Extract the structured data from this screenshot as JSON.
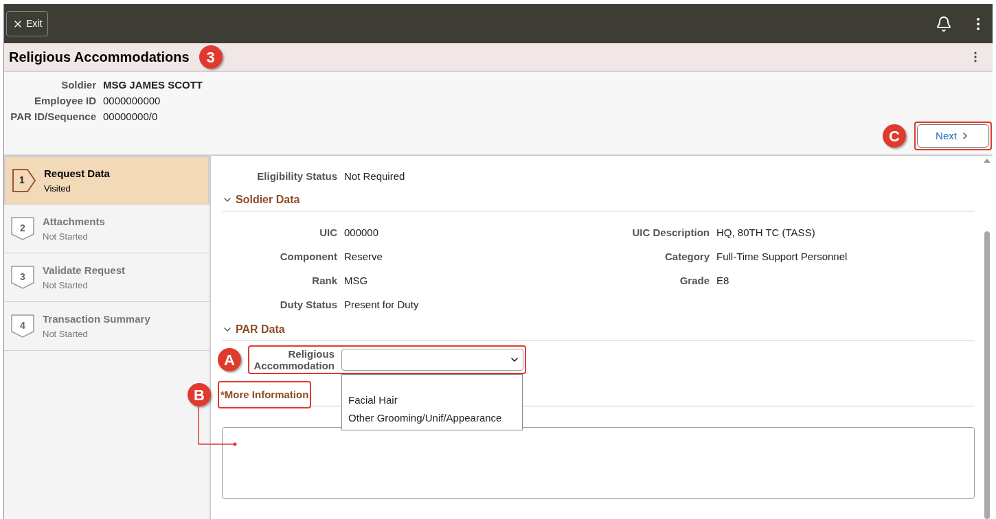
{
  "topbar": {
    "exit_label": "Exit"
  },
  "page": {
    "title": "Religious Accommodations",
    "callout": "3"
  },
  "header_fields": [
    {
      "label": "Soldier",
      "value": "MSG JAMES SCOTT",
      "bold": true
    },
    {
      "label": "Employee ID",
      "value": "0000000000",
      "bold": false
    },
    {
      "label": "PAR ID/Sequence",
      "value": "00000000/0",
      "bold": false
    }
  ],
  "next_button": {
    "label": "Next",
    "callout": "C"
  },
  "steps": [
    {
      "number": "1",
      "title": "Request Data",
      "status": "Visited",
      "selected": true
    },
    {
      "number": "2",
      "title": "Attachments",
      "status": "Not Started",
      "selected": false
    },
    {
      "number": "3",
      "title": "Validate Request",
      "status": "Not Started",
      "selected": false
    },
    {
      "number": "4",
      "title": "Transaction Summary",
      "status": "Not Started",
      "selected": false
    }
  ],
  "eligibility": {
    "label": "Eligibility Status",
    "value": "Not Required"
  },
  "soldier_data": {
    "title": "Soldier Data",
    "expanded": true,
    "left": [
      {
        "label": "UIC",
        "value": "000000"
      },
      {
        "label": "Component",
        "value": "Reserve"
      },
      {
        "label": "Rank",
        "value": "MSG"
      },
      {
        "label": "Duty Status",
        "value": "Present for Duty"
      }
    ],
    "right": [
      {
        "label": "UIC Description",
        "value": "HQ, 80TH TC (TASS)"
      },
      {
        "label": "Category",
        "value": "Full-Time Support Personnel"
      },
      {
        "label": "Grade",
        "value": "E8"
      }
    ]
  },
  "par_data": {
    "title": "PAR Data",
    "expanded": true,
    "dropdown": {
      "label": "Religious Accommodation",
      "callout": "A",
      "expanded": true,
      "options": [
        "Facial Hair",
        "Other Grooming/Unif/Appearance"
      ]
    },
    "more_info": {
      "label": "*More Information",
      "callout": "B"
    }
  }
}
